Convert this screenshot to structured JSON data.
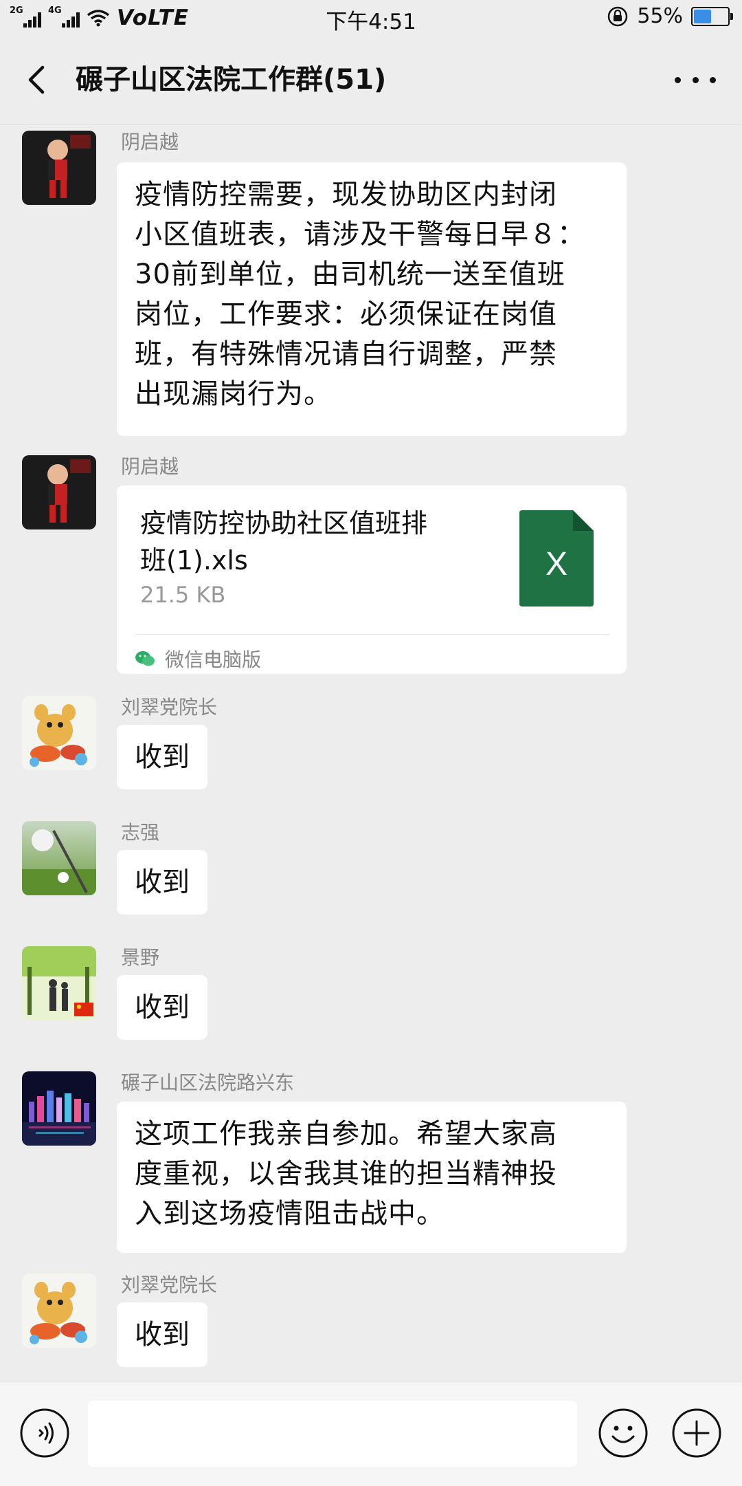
{
  "status_bar": {
    "network_tags": [
      "2G",
      "4G"
    ],
    "volte": "VoLTE",
    "time": "下午4:51",
    "battery_percent": "55%",
    "battery_level": 0.55
  },
  "nav": {
    "title": "碾子山区法院工作群(51)"
  },
  "messages": [
    {
      "sender": "阴启越",
      "type": "text",
      "lines": [
        "疫情防控需要，现发协助区内封闭",
        "小区值班表，请涉及干警每日早８：",
        "30前到单位，由司机统一送至值班",
        "岗位，工作要求：必须保证在岗值",
        "班，有特殊情况请自行调整，严禁",
        "出现漏岗行为。"
      ]
    },
    {
      "sender": "阴启越",
      "type": "file",
      "file_name_lines": [
        "疫情防控协助社区值班排",
        "班(1).xls"
      ],
      "file_size": "21.5 KB",
      "file_icon_letter": "X",
      "source": "微信电脑版"
    },
    {
      "sender": "刘翠党院长",
      "type": "text",
      "text": "收到"
    },
    {
      "sender": "志强",
      "type": "text",
      "text": "收到"
    },
    {
      "sender": "景野",
      "type": "text",
      "text": "收到"
    },
    {
      "sender": "碾子山区法院路兴东",
      "type": "text",
      "lines": [
        "这项工作我亲自参加。希望大家高",
        "度重视，以舍我其谁的担当精神投",
        "入到这场疫情阻击战中。"
      ]
    },
    {
      "sender": "刘翠党院长",
      "type": "text",
      "text": "收到"
    }
  ],
  "colors": {
    "background": "#ededed",
    "bubble": "#ffffff",
    "excel_green": "#1f7244",
    "battery_blue": "#3a8ee6",
    "wechat_green": "#2aae67"
  },
  "icons": {
    "back": "chevron-left-icon",
    "more": "more-dots-icon",
    "voice": "voice-icon",
    "emoji": "emoji-icon",
    "plus": "plus-icon",
    "file": "excel-file-icon"
  }
}
